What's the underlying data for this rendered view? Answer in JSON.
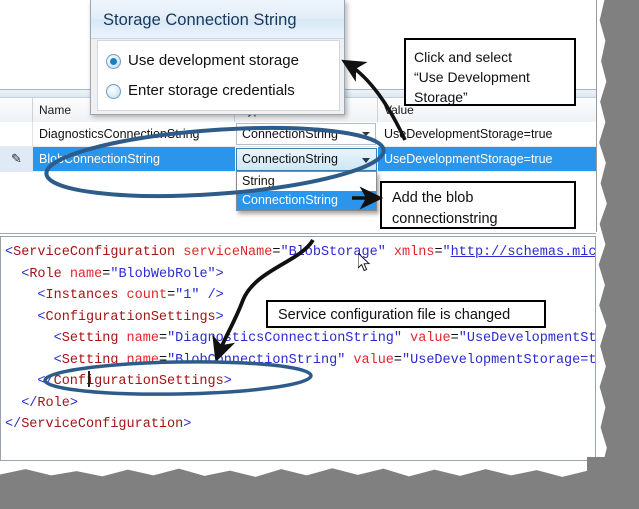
{
  "dialog": {
    "title": "Storage Connection String",
    "options": [
      {
        "label": "Use development storage",
        "selected": true
      },
      {
        "label": "Enter storage credentials",
        "selected": false
      }
    ]
  },
  "grid": {
    "columns": [
      "",
      "Name",
      "Type",
      "Value"
    ],
    "rows": [
      {
        "gutter": "",
        "name": "DiagnosticsConnectionString",
        "type": "ConnectionString",
        "value": "UseDevelopmentStorage=true",
        "selected": false
      },
      {
        "gutter": "pencil-icon",
        "name": "BlobConnectionString",
        "type": "ConnectionString",
        "value": "UseDevelopmentStorage=true",
        "selected": true
      }
    ],
    "dropdown": {
      "open": true,
      "selected_value": "ConnectionString",
      "options": [
        "String",
        "ConnectionString"
      ],
      "highlighted": "ConnectionString"
    }
  },
  "callouts": {
    "click_select": {
      "line1": "Click and select",
      "line2": "“Use Development",
      "line3": "Storage”"
    },
    "add_blob": {
      "line1": "Add the blob",
      "line2": "connectionstring"
    },
    "service_changed": {
      "line1": "Service configuration file is changed"
    }
  },
  "code": {
    "language": "xml",
    "lines": [
      {
        "indent": 0,
        "parts": [
          {
            "t": "<",
            "c": "brk"
          },
          {
            "t": "ServiceConfiguration",
            "c": "tag"
          },
          {
            "t": " ",
            "c": "eq"
          },
          {
            "t": "serviceName",
            "c": "attr"
          },
          {
            "t": "=",
            "c": "eq"
          },
          {
            "t": "\"BlobStorage\"",
            "c": "val"
          },
          {
            "t": " ",
            "c": "eq"
          },
          {
            "t": "xmlns",
            "c": "attr"
          },
          {
            "t": "=",
            "c": "eq"
          },
          {
            "t": "\"",
            "c": "val"
          },
          {
            "t": "http://schemas.microsoft.c",
            "c": "lnk"
          }
        ]
      },
      {
        "indent": 1,
        "parts": [
          {
            "t": "<",
            "c": "brk"
          },
          {
            "t": "Role",
            "c": "tag"
          },
          {
            "t": " ",
            "c": "eq"
          },
          {
            "t": "name",
            "c": "attr"
          },
          {
            "t": "=",
            "c": "eq"
          },
          {
            "t": "\"BlobWebRole\"",
            "c": "val"
          },
          {
            "t": ">",
            "c": "brk"
          }
        ]
      },
      {
        "indent": 2,
        "parts": [
          {
            "t": "<",
            "c": "brk"
          },
          {
            "t": "Instances",
            "c": "tag"
          },
          {
            "t": " ",
            "c": "eq"
          },
          {
            "t": "count",
            "c": "attr"
          },
          {
            "t": "=",
            "c": "eq"
          },
          {
            "t": "\"1\"",
            "c": "val"
          },
          {
            "t": " />",
            "c": "brk"
          }
        ]
      },
      {
        "indent": 2,
        "parts": [
          {
            "t": "<",
            "c": "brk"
          },
          {
            "t": "ConfigurationSettings",
            "c": "tag"
          },
          {
            "t": ">",
            "c": "brk"
          }
        ]
      },
      {
        "indent": 3,
        "parts": [
          {
            "t": "<",
            "c": "brk"
          },
          {
            "t": "Setting",
            "c": "tag"
          },
          {
            "t": " ",
            "c": "eq"
          },
          {
            "t": "name",
            "c": "attr"
          },
          {
            "t": "=",
            "c": "eq"
          },
          {
            "t": "\"DiagnosticsConnectionString\"",
            "c": "val"
          },
          {
            "t": " ",
            "c": "eq"
          },
          {
            "t": "value",
            "c": "attr"
          },
          {
            "t": "=",
            "c": "eq"
          },
          {
            "t": "\"UseDevelopmentStorage=tr",
            "c": "val"
          }
        ]
      },
      {
        "indent": 3,
        "parts": [
          {
            "t": "<",
            "c": "brk"
          },
          {
            "t": "Setting",
            "c": "tag"
          },
          {
            "t": " ",
            "c": "eq"
          },
          {
            "t": "name",
            "c": "attr"
          },
          {
            "t": "=",
            "c": "eq"
          },
          {
            "t": "\"BlobConnectionString\"",
            "c": "val"
          },
          {
            "t": " ",
            "c": "eq"
          },
          {
            "t": "value",
            "c": "attr"
          },
          {
            "t": "=",
            "c": "eq"
          },
          {
            "t": "\"UseDevelopmentStorage=true\"",
            "c": "val"
          },
          {
            "t": " />",
            "c": "brk"
          }
        ]
      },
      {
        "indent": 2,
        "parts": [
          {
            "t": "</",
            "c": "brk"
          },
          {
            "t": "ConfigurationSettings",
            "c": "tag"
          },
          {
            "t": ">",
            "c": "brk"
          }
        ]
      },
      {
        "indent": 1,
        "parts": [
          {
            "t": "</",
            "c": "brk"
          },
          {
            "t": "Role",
            "c": "tag"
          },
          {
            "t": ">",
            "c": "brk"
          }
        ]
      },
      {
        "indent": 0,
        "parts": [
          {
            "t": "</",
            "c": "brk"
          },
          {
            "t": "ServiceConfiguration",
            "c": "tag"
          },
          {
            "t": ">",
            "c": "brk"
          }
        ]
      }
    ]
  },
  "colors": {
    "selection_blue": "#2a95ea",
    "annotation_ink": "#2e5c8a",
    "arrow_black": "#111111",
    "dialog_title_text": "#18375c",
    "xml_tag": "#a31515",
    "xml_attr": "#e4262b",
    "xml_value": "#2b2bd0",
    "torn_edge": "#808080"
  }
}
